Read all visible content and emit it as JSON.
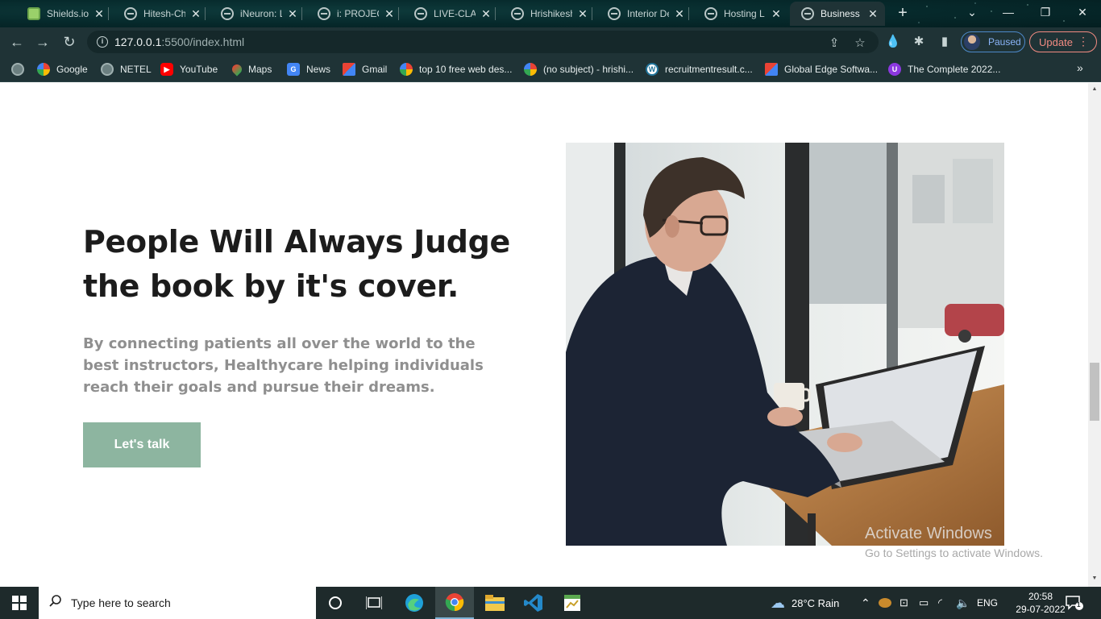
{
  "browser": {
    "tabs": [
      {
        "title": "Shields.io",
        "favicon": "shields-icon",
        "active": false
      },
      {
        "title": "Hitesh-Ch",
        "favicon": "globe-icon",
        "active": false
      },
      {
        "title": "iNeuron: L",
        "favicon": "globe-icon",
        "active": false
      },
      {
        "title": "i: PROJECT",
        "favicon": "globe-icon",
        "active": false
      },
      {
        "title": "LIVE-CLAS",
        "favicon": "globe-icon",
        "active": false
      },
      {
        "title": "Hrishikesh",
        "favicon": "globe-icon",
        "active": false
      },
      {
        "title": "Interior De",
        "favicon": "globe-icon",
        "active": false
      },
      {
        "title": "Hosting L",
        "favicon": "globe-icon",
        "active": false
      },
      {
        "title": "Business L",
        "favicon": "globe-icon",
        "active": true
      }
    ],
    "tab_close_glyph": "✕",
    "new_tab_glyph": "+",
    "url_host": "127.0.0.1",
    "url_path": ":5500/index.html",
    "profile_label": "Paused",
    "update_label": "Update",
    "bookmarks": [
      {
        "label": "",
        "icon": "globe"
      },
      {
        "label": "Google",
        "icon": "google"
      },
      {
        "label": "NETEL",
        "icon": "globe"
      },
      {
        "label": "YouTube",
        "icon": "youtube"
      },
      {
        "label": "Maps",
        "icon": "maps"
      },
      {
        "label": "News",
        "icon": "news"
      },
      {
        "label": "Gmail",
        "icon": "gmail"
      },
      {
        "label": "top 10 free web des...",
        "icon": "google"
      },
      {
        "label": "(no subject) - hrishi...",
        "icon": "google"
      },
      {
        "label": "recruitmentresult.c...",
        "icon": "wordpress"
      },
      {
        "label": "Global Edge Softwa...",
        "icon": "gmail"
      },
      {
        "label": "The Complete 2022...",
        "icon": "purple"
      }
    ]
  },
  "page": {
    "heading": "People Will Always Judge the book by it's cover.",
    "description": "By connecting patients all over the world to the best instructors, Healthycare helping individuals reach their goals and pursue their dreams.",
    "cta_label": "Let's talk",
    "cta_color": "#8db5a0",
    "image_subject": "man-working-on-laptop-photo"
  },
  "watermark": {
    "title": "Activate Windows",
    "subtitle": "Go to Settings to activate Windows."
  },
  "taskbar": {
    "search_placeholder": "Type here to search",
    "weather": "28°C  Rain",
    "language": "ENG",
    "time": "20:58",
    "date": "29-07-2022",
    "notification_count": "1"
  }
}
